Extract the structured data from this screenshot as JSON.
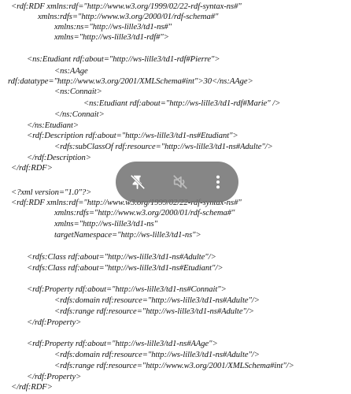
{
  "code_lines": [
    "<rdf:RDF xmlns:rdf=\"http://www.w3.org/1999/02/22-rdf-syntax-ns#\"",
    "xmlns:rdfs=\"http://www.w3.org/2000/01/rdf-schema#\"",
    "xmlns:ns=\"http://ws-lille3/td1-ns#\"",
    "xmlns=\"http://ws-lille3/td1-rdf#\">",
    "<ns:Etudiant rdf:about=\"http://ws-lille3/td1-rdf#Pierre\">",
    "<ns:AAge",
    "rdf:datatype=\"http://www.w3.org/2001/XMLSchema#int\">30</ns:AAge>",
    "<ns:Connait>",
    "<ns:Etudiant rdf:about=\"http://ws-lille3/td1-rdf#Marie\" />",
    "</ns:Connait>",
    "</ns:Etudiant>",
    "<rdf:Description rdf:about=\"http://ws-lille3/td1-ns#Etudiant\">",
    "<rdfs:subClassOf rdf:resource=\"http://ws-lille3/td1-ns#Adulte\"/>",
    "</rdf:Description>",
    "</rdf:RDF>",
    "<?xml version=\"1.0\"?>",
    "<rdf:RDF xmlns:rdf=\"http://www.w3.org/1999/02/22-rdf-syntax-ns#\"",
    "xmlns:rdfs=\"http://www.w3.org/2000/01/rdf-schema#\"",
    "xmlns=\"http://ws-lille3/td1-ns\"",
    "targetNamespace=\"http://ws-lille3/td1-ns\">",
    "<rdfs:Class rdf:about=\"http://ws-lille3/td1-ns#Adulte\"/>",
    "<rdfs:Class rdf:about=\"http://ws-lille3/td1-ns#Etudiant\"/>",
    "<rdf:Property rdf:about=\"http://ws-lille3/td1-ns#Connait\">",
    "<rdfs:domain rdf:resource=\"http://ws-lille3/td1-ns#Adulte\"/>",
    "<rdfs:range rdf:resource=\"http://ws-lille3/td1-ns#Adulte\"/>",
    "</rdf:Property>",
    "<rdf:Property rdf:about=\"http://ws-lille3/td1-ns#AAge\">",
    "<rdfs:domain rdf:resource=\"http://ws-lille3/td1-ns#Adulte\"/>",
    "<rdfs:range rdf:resource=\"http://www.w3.org/2001/XMLSchema#int\"/>",
    "</rdf:Property>",
    "</rdf:RDF>"
  ],
  "overlay": {
    "buttons": [
      {
        "icon": "pin-off-icon",
        "color": "#ffffff"
      },
      {
        "icon": "volume-off-icon",
        "color": "#bdbdbd"
      },
      {
        "icon": "more-vert-icon",
        "color": "#ffffff"
      }
    ],
    "background": "#757575"
  }
}
